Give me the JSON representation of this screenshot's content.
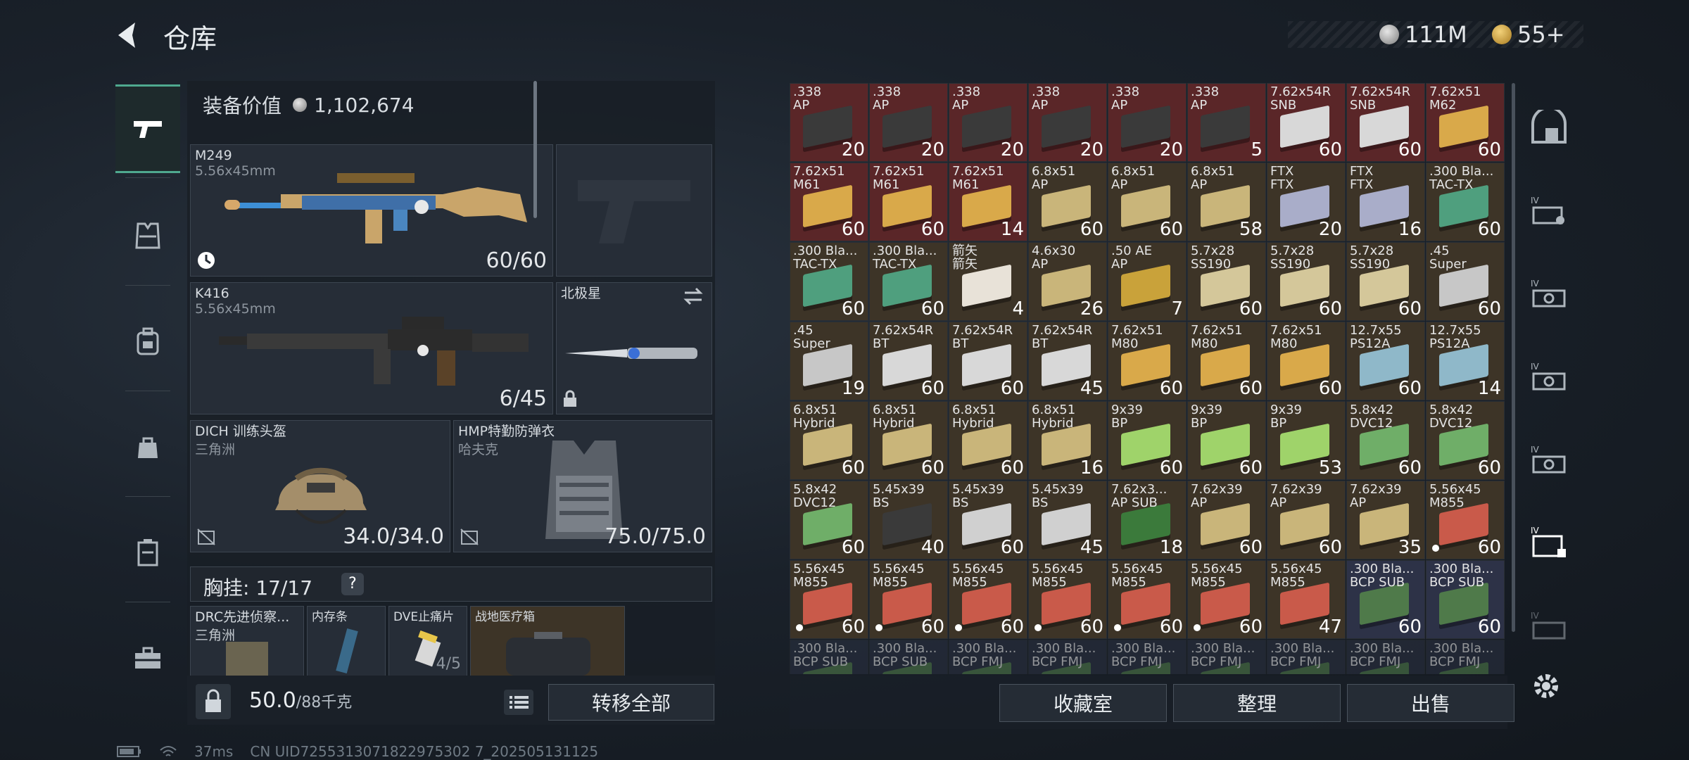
{
  "header": {
    "title": "仓库",
    "currency_silver": "111M",
    "currency_gold": "55+"
  },
  "equipment": {
    "value_label": "装备价值",
    "value": "1,102,674",
    "primary_weapon": {
      "name": "M249",
      "caliber": "5.56x45mm",
      "ammo": "60/60"
    },
    "secondary_weapon": {
      "name": "K416",
      "caliber": "5.56x45mm",
      "ammo": "6/45"
    },
    "melee": {
      "name": "北极星"
    },
    "helmet": {
      "name": "DICH 训练头盔",
      "brand": "三角洲",
      "durability": "34.0/34.0"
    },
    "armor": {
      "name": "HMP特勤防弹衣",
      "brand": "哈夫克",
      "durability": "75.0/75.0"
    },
    "chest_label": "胸挂:",
    "chest_capacity": "17/17",
    "chest_help": "?",
    "chest_items": [
      {
        "name": "DRC先进侦察...",
        "brand": "三角洲"
      },
      {
        "name": "内存条"
      },
      {
        "name": "DVE止痛片",
        "count": "4/5"
      },
      {
        "name": "战地医疗箱"
      }
    ]
  },
  "bottom_left": {
    "weight": "50.0",
    "weight_max": "/88千克",
    "transfer_all": "转移全部"
  },
  "storage": {
    "rows": [
      [
        {
          "name": ".338\nAP",
          "count": "20",
          "color": "red",
          "box": "#3a3a3a"
        },
        {
          "name": ".338\nAP",
          "count": "20",
          "color": "red",
          "box": "#3a3a3a"
        },
        {
          "name": ".338\nAP",
          "count": "20",
          "color": "red",
          "box": "#3a3a3a"
        },
        {
          "name": ".338\nAP",
          "count": "20",
          "color": "red",
          "box": "#3a3a3a"
        },
        {
          "name": ".338\nAP",
          "count": "20",
          "color": "red",
          "box": "#3a3a3a"
        },
        {
          "name": ".338\nAP",
          "count": "5",
          "color": "red",
          "box": "#3a3a3a"
        },
        {
          "name": "7.62x54R\nSNB",
          "count": "60",
          "color": "red",
          "box": "#d8d8d8"
        },
        {
          "name": "7.62x54R\nSNB",
          "count": "60",
          "color": "red",
          "box": "#d8d8d8"
        },
        {
          "name": "7.62x51\nM62",
          "count": "60",
          "color": "red",
          "box": "#d9a94a"
        }
      ],
      [
        {
          "name": "7.62x51\nM61",
          "count": "60",
          "color": "red",
          "box": "#d9a94a"
        },
        {
          "name": "7.62x51\nM61",
          "count": "60",
          "color": "red",
          "box": "#d9a94a"
        },
        {
          "name": "7.62x51\nM61",
          "count": "14",
          "color": "red",
          "box": "#d9a94a"
        },
        {
          "name": "6.8x51\nAP",
          "count": "60",
          "color": "brown",
          "box": "#c9b57a"
        },
        {
          "name": "6.8x51\nAP",
          "count": "60",
          "color": "brown",
          "box": "#c9b57a"
        },
        {
          "name": "6.8x51\nAP",
          "count": "58",
          "color": "brown",
          "box": "#c9b57a"
        },
        {
          "name": "FTX\nFTX",
          "count": "20",
          "color": "brown",
          "box": "#a9adc9"
        },
        {
          "name": "FTX\nFTX",
          "count": "16",
          "color": "brown",
          "box": "#a9adc9"
        },
        {
          "name": ".300 Bla...\nTAC-TX",
          "count": "60",
          "color": "brown",
          "box": "#4f9f7e"
        }
      ],
      [
        {
          "name": ".300 Bla...\nTAC-TX",
          "count": "60",
          "color": "brown",
          "box": "#4f9f7e"
        },
        {
          "name": ".300 Bla...\nTAC-TX",
          "count": "60",
          "color": "brown",
          "box": "#4f9f7e"
        },
        {
          "name": "箭矢\n箭矢",
          "count": "4",
          "color": "brown",
          "box": "#e8e2d8"
        },
        {
          "name": "4.6x30\nAP",
          "count": "26",
          "color": "brown",
          "box": "#c9b57a"
        },
        {
          "name": ".50 AE\nAP",
          "count": "7",
          "color": "brown",
          "box": "#c9a23a"
        },
        {
          "name": "5.7x28\nSS190",
          "count": "60",
          "color": "brown",
          "box": "#d4c79a"
        },
        {
          "name": "5.7x28\nSS190",
          "count": "60",
          "color": "brown",
          "box": "#d4c79a"
        },
        {
          "name": "5.7x28\nSS190",
          "count": "60",
          "color": "brown",
          "box": "#d4c79a"
        },
        {
          "name": ".45\nSuper",
          "count": "60",
          "color": "brown",
          "box": "#c7c7c7"
        }
      ],
      [
        {
          "name": ".45\nSuper",
          "count": "19",
          "color": "brown",
          "box": "#c7c7c7"
        },
        {
          "name": "7.62x54R\nBT",
          "count": "60",
          "color": "brown",
          "box": "#d8d8d8"
        },
        {
          "name": "7.62x54R\nBT",
          "count": "60",
          "color": "brown",
          "box": "#d8d8d8"
        },
        {
          "name": "7.62x54R\nBT",
          "count": "45",
          "color": "brown",
          "box": "#d8d8d8"
        },
        {
          "name": "7.62x51\nM80",
          "count": "60",
          "color": "brown",
          "box": "#d9a94a"
        },
        {
          "name": "7.62x51\nM80",
          "count": "60",
          "color": "brown",
          "box": "#d9a94a"
        },
        {
          "name": "7.62x51\nM80",
          "count": "60",
          "color": "brown",
          "box": "#d9a94a"
        },
        {
          "name": "12.7x55\nPS12A",
          "count": "60",
          "color": "brown",
          "box": "#8fb8c9"
        },
        {
          "name": "12.7x55\nPS12A",
          "count": "14",
          "color": "brown",
          "box": "#8fb8c9"
        }
      ],
      [
        {
          "name": "6.8x51\nHybrid",
          "count": "60",
          "color": "brown",
          "box": "#c9b57a"
        },
        {
          "name": "6.8x51\nHybrid",
          "count": "60",
          "color": "brown",
          "box": "#c9b57a"
        },
        {
          "name": "6.8x51\nHybrid",
          "count": "60",
          "color": "brown",
          "box": "#c9b57a"
        },
        {
          "name": "6.8x51\nHybrid",
          "count": "16",
          "color": "brown",
          "box": "#c9b57a"
        },
        {
          "name": "9x39\nBP",
          "count": "60",
          "color": "brown",
          "box": "#9fd36a"
        },
        {
          "name": "9x39\nBP",
          "count": "60",
          "color": "brown",
          "box": "#9fd36a"
        },
        {
          "name": "9x39\nBP",
          "count": "53",
          "color": "brown",
          "box": "#9fd36a"
        },
        {
          "name": "5.8x42\nDVC12",
          "count": "60",
          "color": "brown",
          "box": "#6fae68"
        },
        {
          "name": "5.8x42\nDVC12",
          "count": "60",
          "color": "brown",
          "box": "#6fae68"
        }
      ],
      [
        {
          "name": "5.8x42\nDVC12",
          "count": "60",
          "color": "brown",
          "box": "#6fae68"
        },
        {
          "name": "5.45x39\nBS",
          "count": "40",
          "color": "brown",
          "box": "#3a3a3a"
        },
        {
          "name": "5.45x39\nBS",
          "count": "60",
          "color": "brown",
          "box": "#d0d0d0"
        },
        {
          "name": "5.45x39\nBS",
          "count": "45",
          "color": "brown",
          "box": "#d0d0d0"
        },
        {
          "name": "7.62x3...\nAP SUB",
          "count": "18",
          "color": "brown",
          "box": "#3b7a3b"
        },
        {
          "name": "7.62x39\nAP",
          "count": "60",
          "color": "brown",
          "box": "#c9b57a"
        },
        {
          "name": "7.62x39\nAP",
          "count": "60",
          "color": "brown",
          "box": "#c9b57a"
        },
        {
          "name": "7.62x39\nAP",
          "count": "35",
          "color": "brown",
          "box": "#c9b57a"
        },
        {
          "name": "5.56x45\nM855",
          "count": "60",
          "color": "brown",
          "box": "#c95a4a"
        }
      ],
      [
        {
          "name": "5.56x45\nM855",
          "count": "60",
          "color": "brown",
          "box": "#c95a4a"
        },
        {
          "name": "5.56x45\nM855",
          "count": "60",
          "color": "brown",
          "box": "#c95a4a"
        },
        {
          "name": "5.56x45\nM855",
          "count": "60",
          "color": "brown",
          "box": "#c95a4a"
        },
        {
          "name": "5.56x45\nM855",
          "count": "60",
          "color": "brown",
          "box": "#c95a4a"
        },
        {
          "name": "5.56x45\nM855",
          "count": "60",
          "color": "brown",
          "box": "#c95a4a"
        },
        {
          "name": "5.56x45\nM855",
          "count": "60",
          "color": "brown",
          "box": "#c95a4a"
        },
        {
          "name": "5.56x45\nM855",
          "count": "47",
          "color": "brown",
          "box": "#c95a4a"
        },
        {
          "name": ".300 Bla...\nBCP SUB",
          "count": "60",
          "color": "blue",
          "box": "#4f7a4a"
        },
        {
          "name": ".300 Bla...\nBCP SUB",
          "count": "60",
          "color": "blue",
          "box": "#4f7a4a"
        }
      ],
      [
        {
          "name": ".300 Bla...\nBCP SUB",
          "count": "",
          "color": "dim",
          "box": "#4f7a4a"
        },
        {
          "name": ".300 Bla...\nBCP SUB",
          "count": "",
          "color": "dim",
          "box": "#4f7a4a"
        },
        {
          "name": ".300 Bla...\nBCP FMJ",
          "count": "",
          "color": "dim",
          "box": "#4f7a4a"
        },
        {
          "name": ".300 Bla...\nBCP FMJ",
          "count": "",
          "color": "dim",
          "box": "#4f7a4a"
        },
        {
          "name": ".300 Bla...\nBCP FMJ",
          "count": "",
          "color": "dim",
          "box": "#4f7a4a"
        },
        {
          "name": ".300 Bla...\nBCP FMJ",
          "count": "",
          "color": "dim",
          "box": "#4f7a4a"
        },
        {
          "name": ".300 Bla...\nBCP FMJ",
          "count": "",
          "color": "dim",
          "box": "#4f7a4a"
        },
        {
          "name": ".300 Bla...\nBCP FMJ",
          "count": "",
          "color": "dim",
          "box": "#4f7a4a"
        },
        {
          "name": ".300 Bla...\nBCP FMJ",
          "count": "",
          "color": "dim",
          "box": "#4f7a4a"
        }
      ]
    ],
    "dot_rows": [
      5,
      6
    ]
  },
  "bottom_right": {
    "collection": "收藏室",
    "organize": "整理",
    "sell": "出售"
  },
  "status": {
    "ping": "37ms",
    "uid": "CN UID7255313071822975302 7_202505131125"
  },
  "icons": {
    "back": "back-arrow-icon",
    "settings": "gear-icon"
  }
}
